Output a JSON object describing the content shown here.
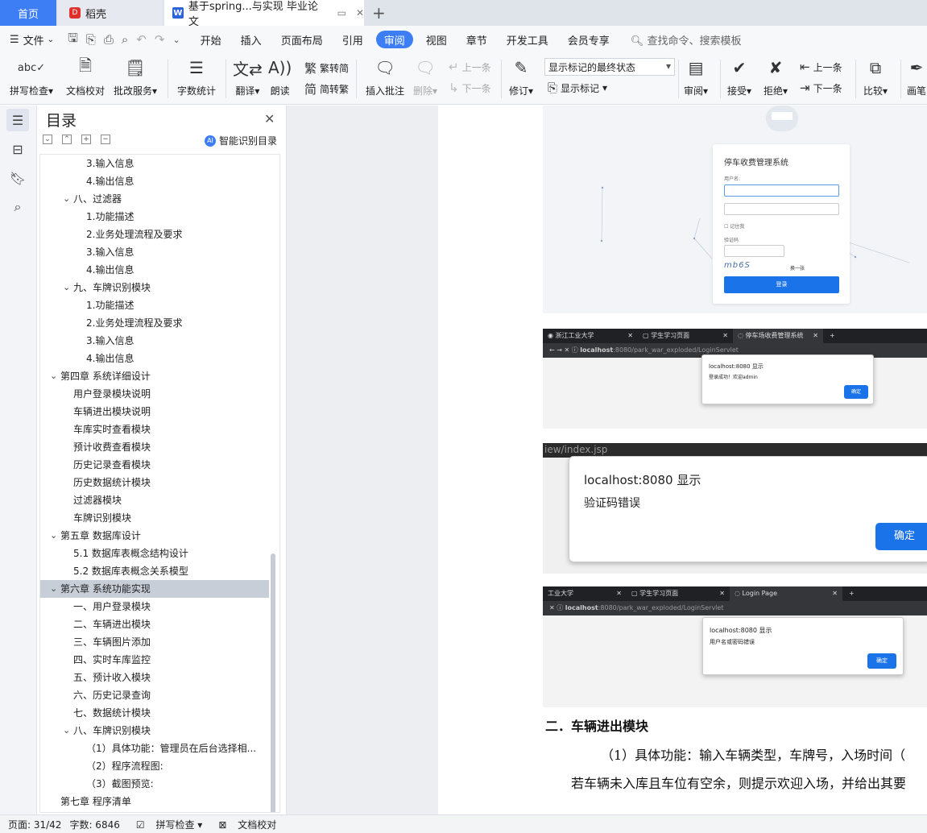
{
  "tabs": {
    "home": "首页",
    "daoke": "稻壳",
    "doc": "基于spring...与实现 毕业论文",
    "add": "+"
  },
  "menu": {
    "file": "文件",
    "items": [
      "开始",
      "插入",
      "页面布局",
      "引用",
      "审阅",
      "视图",
      "章节",
      "开发工具",
      "会员专享"
    ],
    "active": "审阅",
    "search": "查找命令、搜索模板"
  },
  "ribbon": {
    "spell": "拼写检查",
    "doccheck": "文档校对",
    "approve": "批改服务",
    "wordcount": "字数统计",
    "translate": "翻译",
    "read": "朗读",
    "trad": "繁转简",
    "simp": "简转繁",
    "insert_comment": "插入批注",
    "delete": "删除",
    "prev_comment": "上一条",
    "next_comment": "下一条",
    "revise": "修订",
    "markup_state": "显示标记的最终状态",
    "show_markup": "显示标记",
    "review": "审阅",
    "accept": "接受",
    "reject": "拒绝",
    "prev_change": "上一条",
    "next_change": "下一条",
    "compare": "比较",
    "pen": "画笔"
  },
  "toc": {
    "title": "目录",
    "smart": "智能识别目录",
    "items": [
      {
        "text": "3.输入信息",
        "level": 3,
        "expander": "none"
      },
      {
        "text": "4.输出信息",
        "level": 3,
        "expander": "none"
      },
      {
        "text": "八、过滤器",
        "level": 2,
        "expander": "open"
      },
      {
        "text": "1.功能描述",
        "level": 3,
        "expander": "none"
      },
      {
        "text": "2.业务处理流程及要求",
        "level": 3,
        "expander": "none"
      },
      {
        "text": "3.输入信息",
        "level": 3,
        "expander": "none"
      },
      {
        "text": "4.输出信息",
        "level": 3,
        "expander": "none"
      },
      {
        "text": "九、车牌识别模块",
        "level": 2,
        "expander": "open"
      },
      {
        "text": "1.功能描述",
        "level": 3,
        "expander": "none"
      },
      {
        "text": "2.业务处理流程及要求",
        "level": 3,
        "expander": "none"
      },
      {
        "text": "3.输入信息",
        "level": 3,
        "expander": "none"
      },
      {
        "text": "4.输出信息",
        "level": 3,
        "expander": "none"
      },
      {
        "text": "第四章  系统详细设计",
        "level": 1,
        "expander": "open"
      },
      {
        "text": "用户登录模块说明",
        "level": 2,
        "expander": "none"
      },
      {
        "text": "车辆进出模块说明",
        "level": 2,
        "expander": "none"
      },
      {
        "text": "车库实时查看模块",
        "level": 2,
        "expander": "none"
      },
      {
        "text": "预计收费查看模块",
        "level": 2,
        "expander": "none"
      },
      {
        "text": "历史记录查看模块",
        "level": 2,
        "expander": "none"
      },
      {
        "text": "历史数据统计模块",
        "level": 2,
        "expander": "none"
      },
      {
        "text": "过滤器模块",
        "level": 2,
        "expander": "none"
      },
      {
        "text": "车牌识别模块",
        "level": 2,
        "expander": "none"
      },
      {
        "text": "第五章  数据库设计",
        "level": 1,
        "expander": "open"
      },
      {
        "text": "5.1 数据库表概念结构设计",
        "level": 2,
        "expander": "none"
      },
      {
        "text": "5.2 数据库表概念关系模型",
        "level": 2,
        "expander": "none"
      },
      {
        "text": "第六章  系统功能实现",
        "level": 1,
        "expander": "open",
        "selected": true
      },
      {
        "text": "一、用户登录模块",
        "level": 2,
        "expander": "none"
      },
      {
        "text": "二、车辆进出模块",
        "level": 2,
        "expander": "none"
      },
      {
        "text": "三、车辆图片添加",
        "level": 2,
        "expander": "none"
      },
      {
        "text": "四、实时车库监控",
        "level": 2,
        "expander": "none"
      },
      {
        "text": "五、预计收入模块",
        "level": 2,
        "expander": "none"
      },
      {
        "text": "六、历史记录查询",
        "level": 2,
        "expander": "none"
      },
      {
        "text": "七、数据统计模块",
        "level": 2,
        "expander": "none"
      },
      {
        "text": "八、车牌识别模块",
        "level": 2,
        "expander": "open"
      },
      {
        "text": "（1）具体功能：管理员在后台选择相...",
        "level": 3,
        "expander": "none"
      },
      {
        "text": "（2）程序流程图:",
        "level": 3,
        "expander": "none"
      },
      {
        "text": "（3）截图预览:",
        "level": 3,
        "expander": "none"
      },
      {
        "text": "第七章  程序清单",
        "level": 1,
        "expander": "none"
      }
    ]
  },
  "document": {
    "img1": {
      "title": "停车收费管理系统",
      "username_label": "用户名:",
      "remember": "记住我",
      "captcha_label": "验证码",
      "captcha": "mb6S",
      "swap": "换一张",
      "login": "登录"
    },
    "img2": {
      "tab1": "浙江工业大学",
      "tab2": "学生学习页面",
      "tab3": "停车场收费管理系统",
      "url_host": "localhost",
      "url_rest": ":8080/park_war_exploded/LoginServlet",
      "dialog_title": "localhost:8080 显示",
      "dialog_msg": "登录成功！欢迎admin",
      "ok": "确定"
    },
    "img3": {
      "url_fragment": "iew/index.jsp",
      "dialog_title": "localhost:8080 显示",
      "dialog_msg": "验证码错误",
      "ok": "确定"
    },
    "img4": {
      "tab1": "工业大学",
      "tab2": "学生学习页面",
      "tab3": "Login Page",
      "url_host": "localhost",
      "url_rest": ":8080/park_war_exploded/LoginServlet",
      "dialog_title": "localhost:8080 显示",
      "dialog_msg": "用户名或密码错误",
      "ok": "确定"
    },
    "heading": "二．车辆进出模块",
    "para1": "（1）具体功能：输入车辆类型，车牌号，入场时间（",
    "para2": "若车辆未入库且车位有空余，则提示欢迎入场，并给出其要"
  },
  "status": {
    "page": "页面: 31/42",
    "words": "字数: 6846",
    "spell": "拼写检查",
    "doccheck": "文档校对"
  }
}
